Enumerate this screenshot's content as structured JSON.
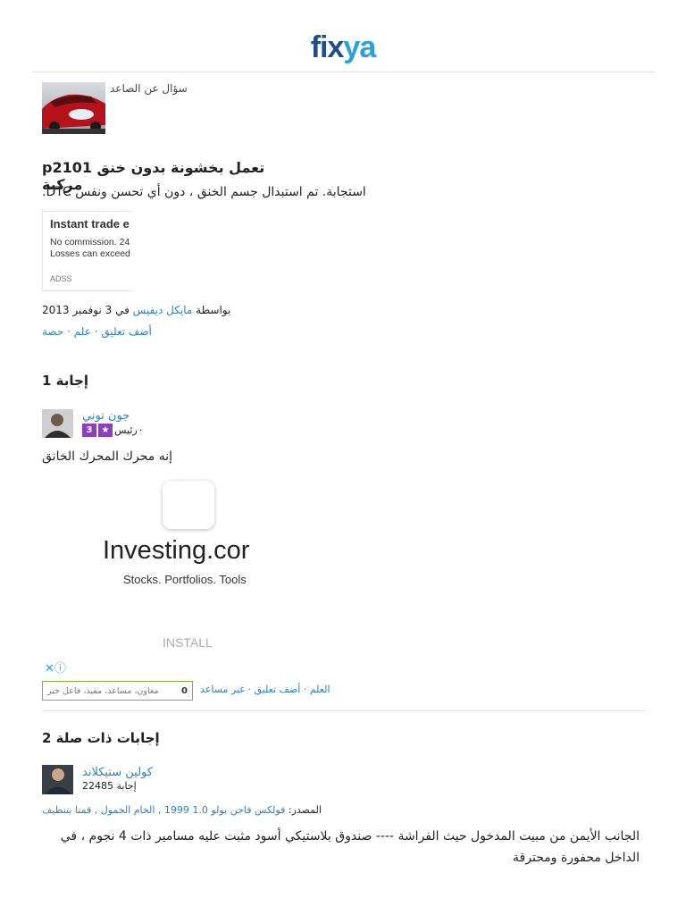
{
  "brand": {
    "logo_part1": "fix",
    "logo_part2": "ya"
  },
  "question": {
    "category": "سؤال عن الصاعد",
    "title": "تعمل بخشونة بدون خنق p2101 مركبة",
    "body": "استجابة. تم استبدال جسم الخنق ، دون أي تحسن ونفس DTC.",
    "by_label": "بواسطة",
    "author": "مايكل ديفيس",
    "date": "في 3 نوفمبر 2013",
    "actions": [
      "أضف تعليق",
      "علم",
      "حصة"
    ],
    "separator": "·"
  },
  "ad_trade": {
    "title": "Instant trade e",
    "line1": "No commission. 24",
    "line2": "Losses can exceed",
    "brand": "ADSS"
  },
  "answers": {
    "heading": "إجابة 1",
    "items": [
      {
        "name": "جون توني",
        "role": "رئيس",
        "badge_count": "3",
        "text": "إنه محرك المحرك الخانق",
        "vote_count": "0",
        "vote_placeholder": "معاون، مساعد، مفيد، فاعل خير",
        "actions": [
          "العلم",
          "أضف تعليق",
          "غير مساعد"
        ]
      }
    ]
  },
  "ad_investing": {
    "name": "Investing.cor",
    "tagline": "Stocks. Portfolios. Tools",
    "install": "INSTALL",
    "close": "✕ⓘ"
  },
  "related": {
    "heading": "إجابات ذات صلة 2",
    "items": [
      {
        "name": "كولين ستيكلاند",
        "count": "إجابة 22485",
        "source_label": "المصدر:",
        "source_link": "فولكس فاجن بولو 1.0 1999 , الخام الخمول , قمنا بتنظيف",
        "text": "الجانب الأيمن من مبيت المدخول حيث الفراشة ---- صندوق بلاستيكي أسود مثبت عليه مسامير ذات 4 نجوم ، في الداخل محفورة ومحترقة"
      }
    ]
  },
  "colors": {
    "link": "#2f7fc1",
    "logo_dark": "#1d4f8c",
    "logo_light": "#2aa0e0",
    "badge": "#8a3fbf",
    "vote_border": "#7fb43a"
  }
}
